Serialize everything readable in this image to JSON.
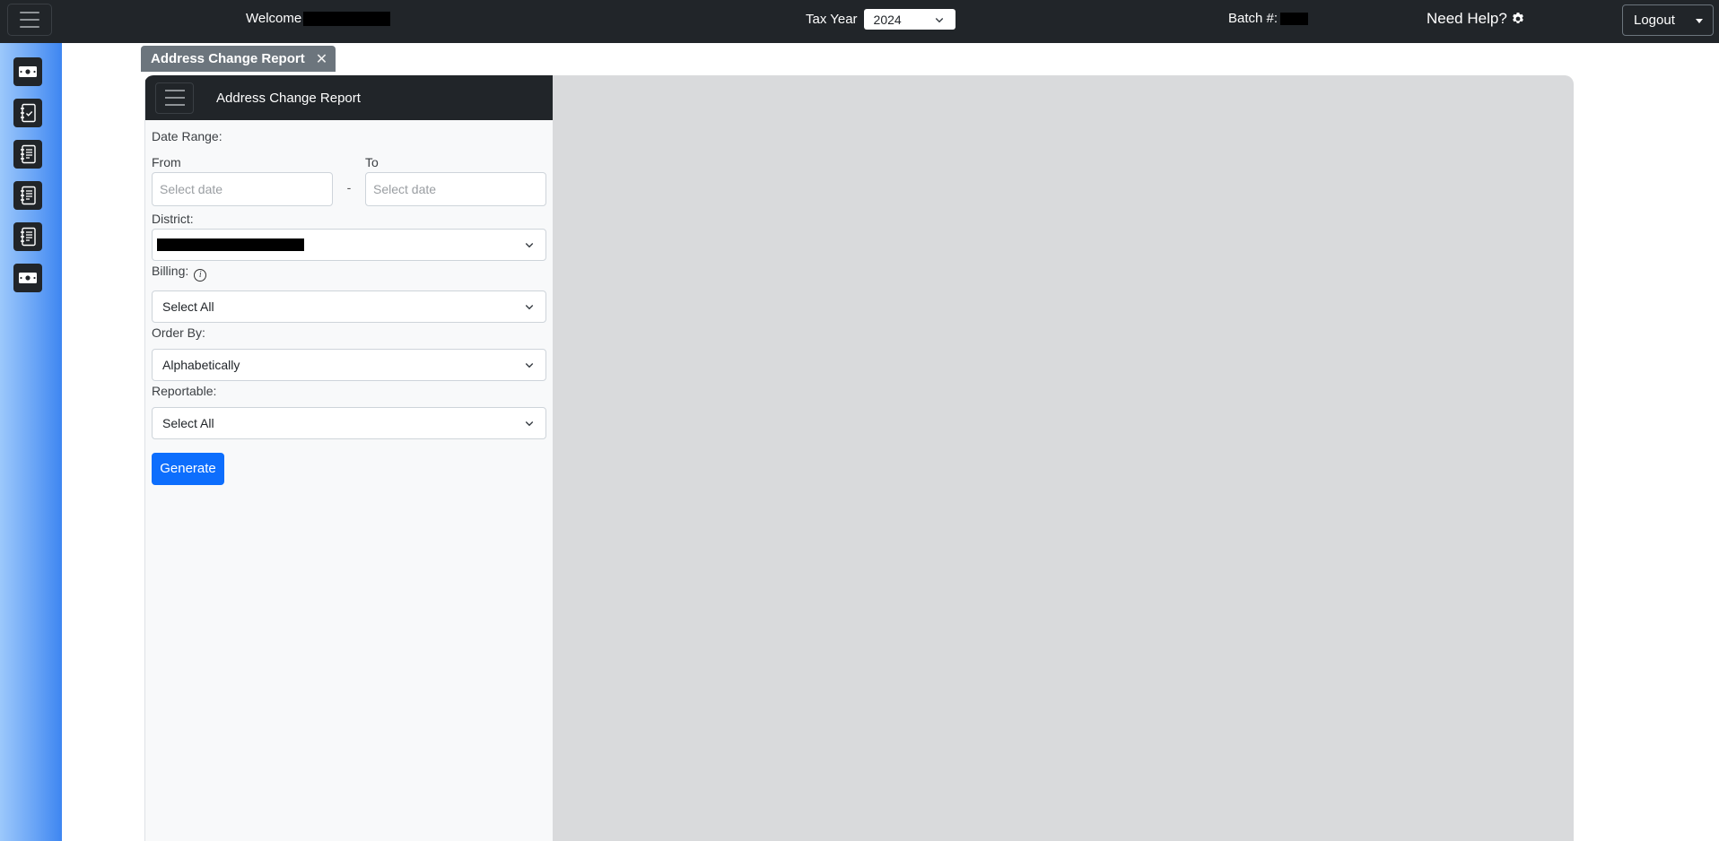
{
  "topbar": {
    "welcome_label": "Welcome",
    "tax_year_label": "Tax Year",
    "tax_year_value": "2024",
    "batch_label": "Batch #:",
    "help_label": "Need Help?",
    "logout_label": "Logout"
  },
  "sidebar": {
    "items": [
      {
        "icon": "money-icon"
      },
      {
        "icon": "checklist-icon"
      },
      {
        "icon": "journal-text-icon"
      },
      {
        "icon": "journal-text-icon"
      },
      {
        "icon": "journal-text-icon"
      },
      {
        "icon": "money-icon"
      }
    ]
  },
  "tabs": [
    {
      "label": "Address Change Report",
      "close": "✕"
    }
  ],
  "panel": {
    "title": "Address Change Report"
  },
  "form": {
    "date_range_label": "Date Range:",
    "from_label": "From",
    "to_label": "To",
    "from_placeholder": "Select date",
    "to_placeholder": "Select date",
    "dash": "-",
    "district_label": "District:",
    "billing_label": "Billing:",
    "billing_value": "Select All",
    "info_glyph": "i",
    "order_by_label": "Order By:",
    "order_by_value": "Alphabetically",
    "reportable_label": "Reportable:",
    "reportable_value": "Select All",
    "generate_label": "Generate"
  },
  "colors": {
    "navbar": "#212529",
    "primary": "#0d6efd",
    "tab": "#6c757d",
    "report_bg": "#d9dadc"
  }
}
